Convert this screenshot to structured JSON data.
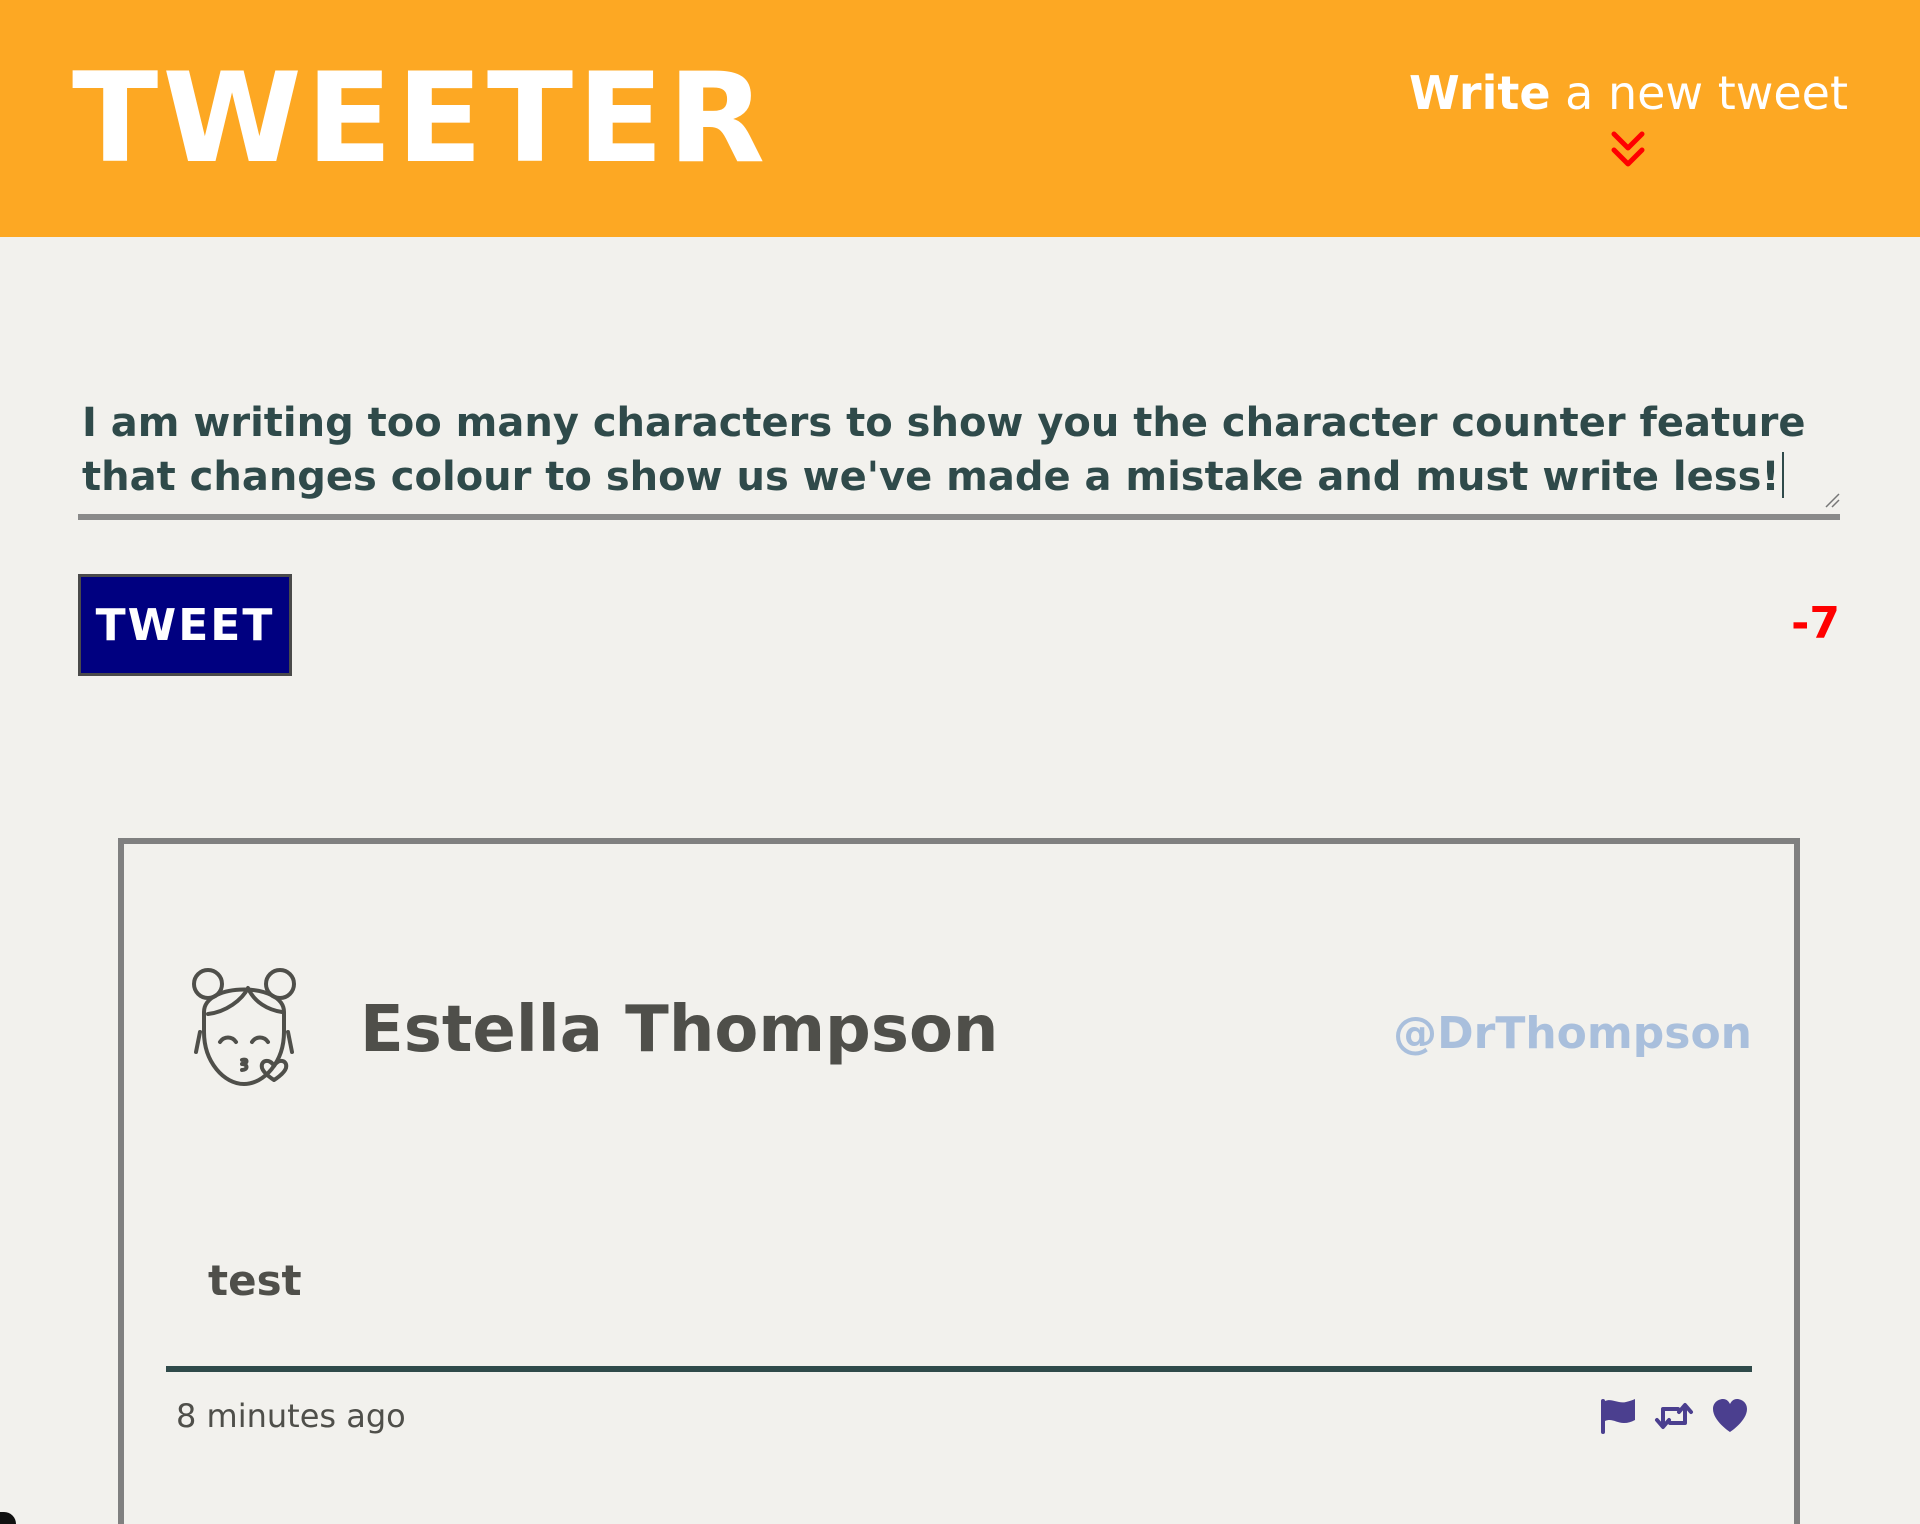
{
  "header": {
    "brand": "TWEETER",
    "compose_toggle": {
      "strong": "Write",
      "rest": " a new tweet",
      "icon": "double-chevron-down-icon"
    }
  },
  "composer": {
    "text": "I am writing too many characters to show you the character counter feature that changes colour to show us we've made a mistake and must write less!",
    "button_label": "TWEET",
    "counter": "-7"
  },
  "tweet": {
    "avatar_icon": "kissing-girl-avatar-icon",
    "name": "Estella Thompson",
    "handle": "@DrThompson",
    "body": "test",
    "timestamp": "8 minutes ago",
    "actions": [
      "flag-icon",
      "retweet-icon",
      "heart-icon"
    ]
  },
  "colors": {
    "header_bg": "#fda823",
    "page_bg": "#f2f1ed",
    "button_bg": "#000080",
    "counter_over_limit": "#ff0000",
    "handle": "#a9bfdc",
    "action_icons": "#4b3f8f",
    "chevron": "#ff0000"
  }
}
